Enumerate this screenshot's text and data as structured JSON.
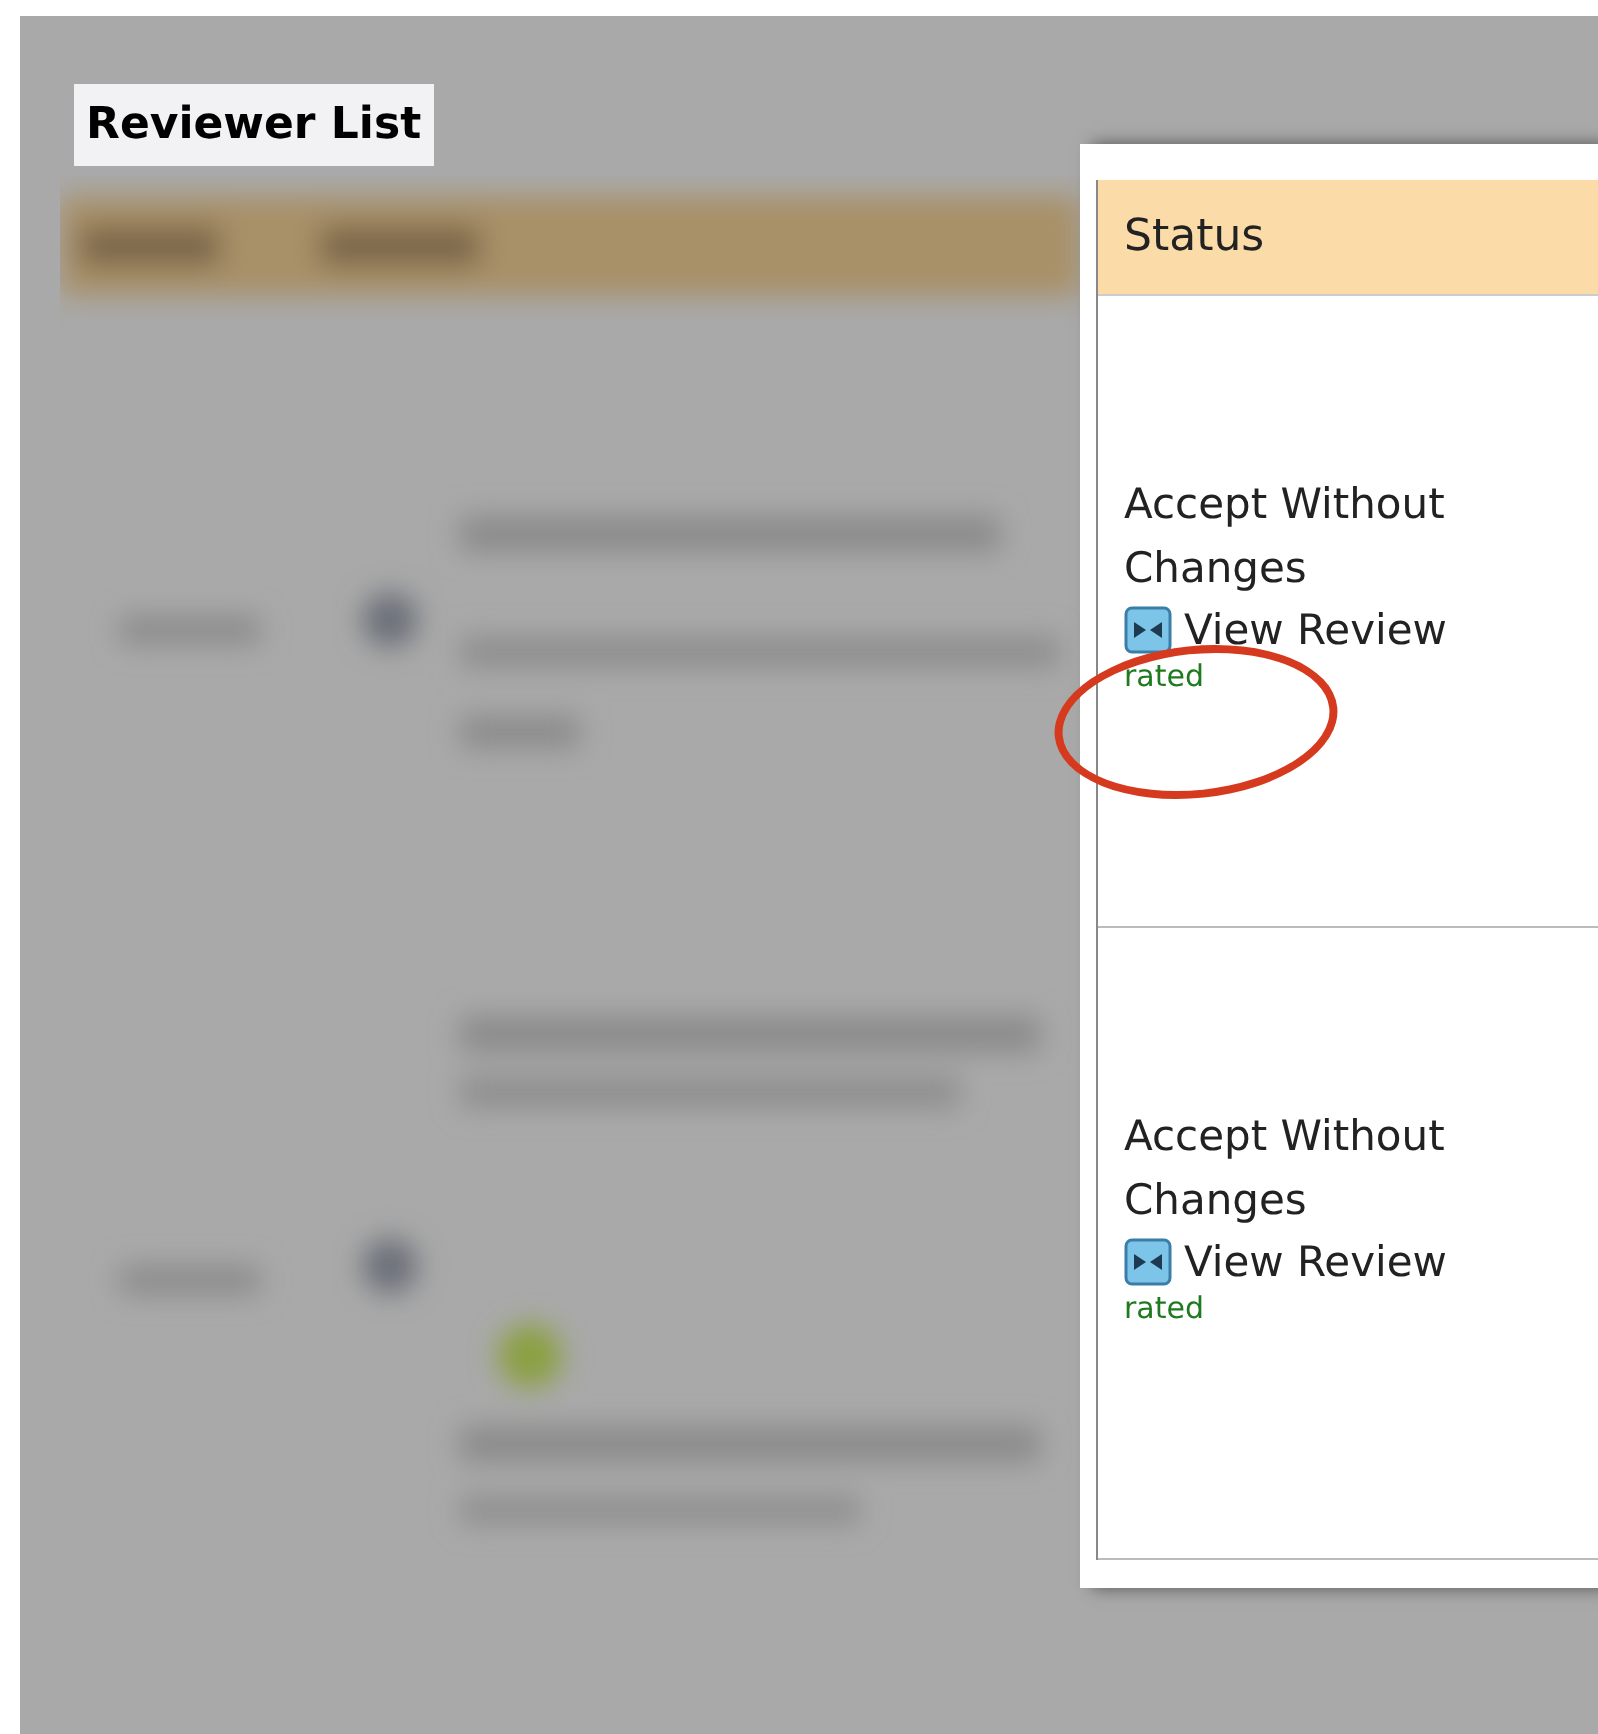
{
  "section_title": "Reviewer List",
  "table": {
    "columns": [
      "Status"
    ],
    "rows": [
      {
        "status": "Accept Without Changes",
        "link": "View Review",
        "note": "rated",
        "highlighted": true
      },
      {
        "status": "Accept Without Changes",
        "link": "View Review",
        "note": "rated",
        "highlighted": false
      }
    ]
  }
}
